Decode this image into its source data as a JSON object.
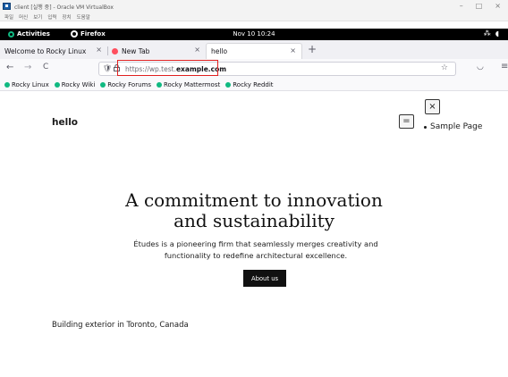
{
  "vbox": {
    "title": "client [실행 중] - Oracle VM VirtualBox",
    "menu": [
      "파일",
      "머신",
      "보기",
      "입력",
      "장치",
      "도움말"
    ],
    "window_controls": [
      "–",
      "□",
      "×"
    ]
  },
  "gnome": {
    "activities": "Activities",
    "app": "Firefox",
    "clock": "Nov 10  10:24"
  },
  "tabs": [
    {
      "label": "Welcome to Rocky Linux",
      "close": "×"
    },
    {
      "label": "New Tab",
      "close": "×"
    },
    {
      "label": "hello",
      "close": "×"
    }
  ],
  "newtab": "+",
  "nav": {
    "back": "←",
    "forward": "→",
    "reload": "C"
  },
  "url": {
    "scheme": "https://wp.test.",
    "host": "example.com"
  },
  "bookmarks": [
    "Rocky Linux",
    "Rocky Wiki",
    "Rocky Forums",
    "Rocky Mattermost",
    "Rocky Reddit"
  ],
  "page": {
    "site_title": "hello",
    "hamburger": "=",
    "close": "×",
    "nav_items": [
      "Sample Page"
    ],
    "hero_title": "A commitment to innovation and sustainability",
    "hero_sub": "Études is a pioneering firm that seamlessly merges creativity and functionality to redefine architectural excellence.",
    "button": "About us",
    "caption": "Building exterior in Toronto, Canada"
  }
}
